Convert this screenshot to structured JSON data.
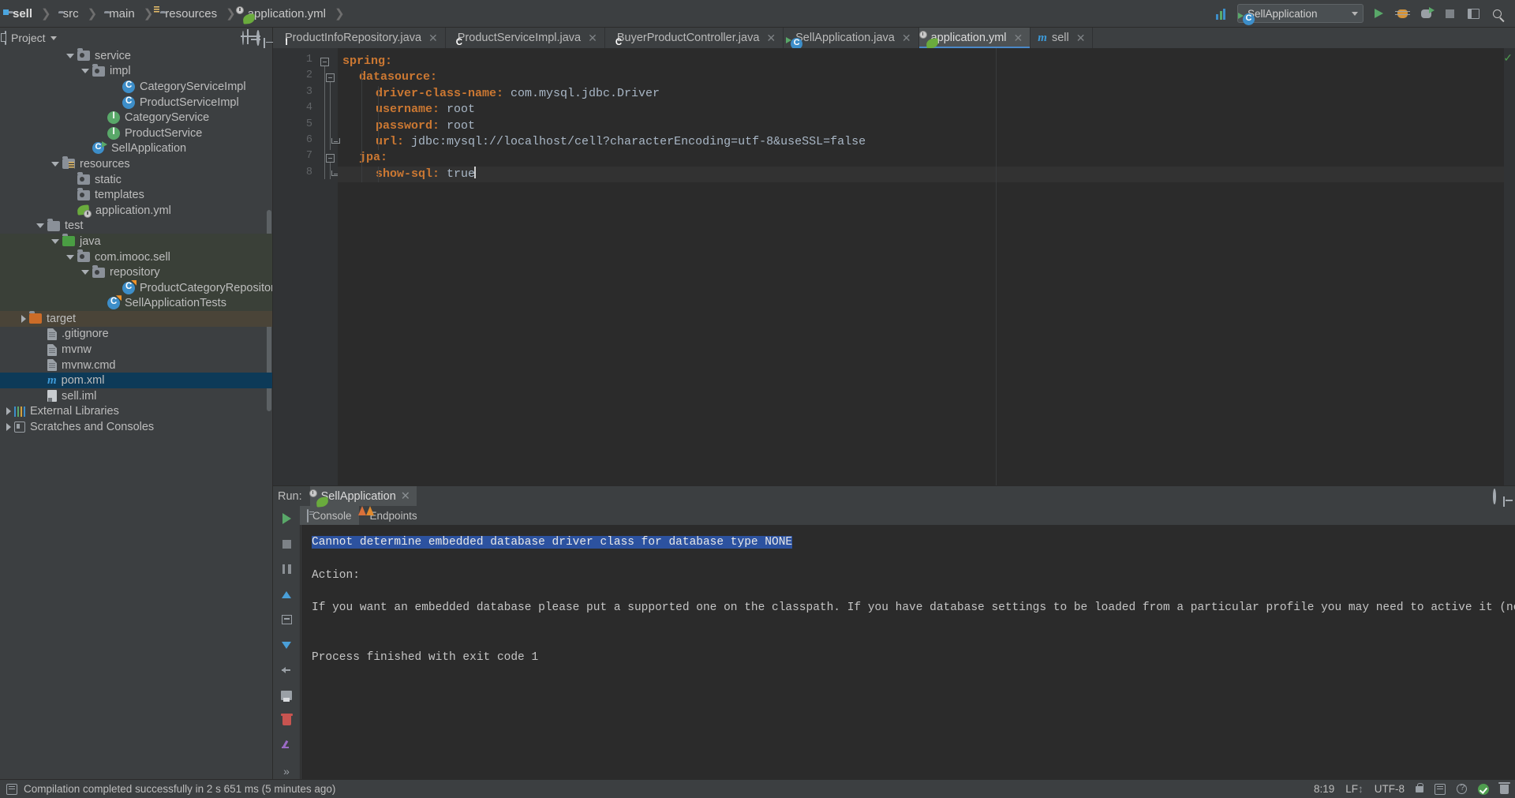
{
  "window": {
    "breadcrumb": [
      {
        "label": "sell",
        "icon": "module-folder-icon"
      },
      {
        "label": "src",
        "icon": "folder-icon"
      },
      {
        "label": "main",
        "icon": "folder-icon"
      },
      {
        "label": "resources",
        "icon": "resources-folder-icon"
      },
      {
        "label": "application.yml",
        "icon": "spring-yml-icon"
      }
    ],
    "run_configuration": "SellApplication",
    "toolbar_icons": [
      "update-icon",
      "run-icon",
      "debug-icon",
      "run-with-coverage-icon",
      "stop-icon",
      "layout-icon",
      "search-icon"
    ]
  },
  "project_pane": {
    "title": "Project",
    "tools": [
      "target-icon",
      "collapse-all-icon",
      "settings-gear-icon",
      "hide-icon"
    ],
    "tree": [
      {
        "label": "service",
        "indent": 4,
        "arrow": "down",
        "icon": "package-folder-icon"
      },
      {
        "label": "impl",
        "indent": 5,
        "arrow": "down",
        "icon": "package-folder-icon"
      },
      {
        "label": "CategoryServiceImpl",
        "indent": 7,
        "arrow": "none",
        "icon": "java-class-icon"
      },
      {
        "label": "ProductServiceImpl",
        "indent": 7,
        "arrow": "none",
        "icon": "java-class-icon"
      },
      {
        "label": "CategoryService",
        "indent": 6,
        "arrow": "none",
        "icon": "java-interface-icon"
      },
      {
        "label": "ProductService",
        "indent": 6,
        "arrow": "none",
        "icon": "java-interface-icon"
      },
      {
        "label": "SellApplication",
        "indent": 5,
        "arrow": "none",
        "icon": "spring-boot-app-icon"
      },
      {
        "label": "resources",
        "indent": 3,
        "arrow": "down",
        "icon": "resources-folder-icon"
      },
      {
        "label": "static",
        "indent": 4,
        "arrow": "none",
        "icon": "package-folder-icon"
      },
      {
        "label": "templates",
        "indent": 4,
        "arrow": "none",
        "icon": "package-folder-icon"
      },
      {
        "label": "application.yml",
        "indent": 4,
        "arrow": "none",
        "icon": "spring-yml-icon"
      },
      {
        "label": "test",
        "indent": 2,
        "arrow": "down",
        "icon": "folder-icon"
      },
      {
        "label": "java",
        "indent": 3,
        "arrow": "down",
        "icon": "green-source-folder-icon",
        "row_style": "test"
      },
      {
        "label": "com.imooc.sell",
        "indent": 4,
        "arrow": "down",
        "icon": "package-folder-icon",
        "row_style": "test"
      },
      {
        "label": "repository",
        "indent": 5,
        "arrow": "down",
        "icon": "package-folder-icon",
        "row_style": "test"
      },
      {
        "label": "ProductCategoryRepositoryTest",
        "indent": 7,
        "arrow": "none",
        "icon": "java-test-class-icon",
        "row_style": "test"
      },
      {
        "label": "SellApplicationTests",
        "indent": 6,
        "arrow": "none",
        "icon": "java-test-class-icon",
        "row_style": "test"
      },
      {
        "label": "target",
        "indent": 1,
        "arrow": "right",
        "icon": "orange-folder-icon",
        "row_style": "target"
      },
      {
        "label": ".gitignore",
        "indent": 2,
        "arrow": "none",
        "icon": "file-icon"
      },
      {
        "label": "mvnw",
        "indent": 2,
        "arrow": "none",
        "icon": "file-icon"
      },
      {
        "label": "mvnw.cmd",
        "indent": 2,
        "arrow": "none",
        "icon": "file-icon"
      },
      {
        "label": "pom.xml",
        "indent": 2,
        "arrow": "none",
        "icon": "maven-icon",
        "row_style": "selected"
      },
      {
        "label": "sell.iml",
        "indent": 2,
        "arrow": "none",
        "icon": "iml-icon"
      },
      {
        "label": "External Libraries",
        "indent": 0,
        "arrow": "right",
        "icon": "libraries-icon"
      },
      {
        "label": "Scratches and Consoles",
        "indent": 0,
        "arrow": "right",
        "icon": "scratches-icon"
      }
    ]
  },
  "editor": {
    "tabs": [
      {
        "label": "ProductInfoRepository.java",
        "icon": "java-interface-icon",
        "active": false,
        "closable": true
      },
      {
        "label": "ProductServiceImpl.java",
        "icon": "java-class-icon",
        "active": false,
        "closable": true
      },
      {
        "label": "BuyerProductController.java",
        "icon": "java-class-icon",
        "active": false,
        "closable": true
      },
      {
        "label": "SellApplication.java",
        "icon": "spring-boot-app-icon",
        "active": false,
        "closable": true
      },
      {
        "label": "application.yml",
        "icon": "spring-yml-icon",
        "active": true,
        "closable": true
      },
      {
        "label": "sell",
        "icon": "maven-icon",
        "active": false,
        "closable": true
      }
    ],
    "lines": [
      {
        "n": "1",
        "indent": 0,
        "key": "spring:",
        "value": "",
        "fold": "start"
      },
      {
        "n": "2",
        "indent": 1,
        "key": "datasource:",
        "value": "",
        "fold": "start"
      },
      {
        "n": "3",
        "indent": 2,
        "key": "driver-class-name:",
        "value": " com.mysql.jdbc.Driver",
        "fold": "none"
      },
      {
        "n": "4",
        "indent": 2,
        "key": "username:",
        "value": " root",
        "fold": "none"
      },
      {
        "n": "5",
        "indent": 2,
        "key": "password:",
        "value": " root",
        "fold": "none"
      },
      {
        "n": "6",
        "indent": 2,
        "key": "url:",
        "value": " jdbc:mysql://localhost/cell?characterEncoding=utf-8&useSSL=false",
        "fold": "end"
      },
      {
        "n": "7",
        "indent": 1,
        "key": "jpa:",
        "value": "",
        "fold": "start"
      },
      {
        "n": "8",
        "indent": 2,
        "key": "show-sql:",
        "value": " true",
        "fold": "end",
        "caret": true
      }
    ],
    "inspection_status": "ok-check-icon"
  },
  "run_panel": {
    "label": "Run:",
    "config_name": "SellApplication",
    "sub_tabs": [
      {
        "label": "Console",
        "icon": "console-icon",
        "active": true
      },
      {
        "label": "Endpoints",
        "icon": "endpoints-icon",
        "active": false
      }
    ],
    "side_icons": [
      "rerun-icon",
      "stop-icon",
      "pause-icon",
      "scroll-up-icon",
      "scroll-down-icon",
      "print-icon",
      "soft-wrap-icon",
      "clear-all-icon",
      "pin-icon",
      "more-icon"
    ],
    "header_icons": [
      "settings-gear-icon",
      "hide-icon"
    ],
    "console_lines": [
      {
        "text": "Cannot determine embedded database driver class for database type NONE",
        "highlighted": true
      },
      {
        "text": "",
        "highlighted": false
      },
      {
        "text": "Action:",
        "highlighted": false
      },
      {
        "text": "",
        "highlighted": false
      },
      {
        "text": "If you want an embedded database please put a supported one on the classpath. If you have database settings to be loaded from a particular profile you may need to active it (no profiles are currently active).",
        "highlighted": false
      },
      {
        "text": "",
        "highlighted": false
      },
      {
        "text": "",
        "highlighted": false
      },
      {
        "text": "Process finished with exit code 1",
        "highlighted": false
      }
    ]
  },
  "status_bar": {
    "message": "Compilation completed successfully in 2 s 651 ms (5 minutes ago)",
    "caret_position": "8:19",
    "line_separator": "LF",
    "encoding": "UTF-8",
    "icons": [
      "lock-icon",
      "event-log-icon",
      "help-icon",
      "inspections-ok-icon",
      "trash-icon"
    ]
  },
  "colors": {
    "accent_blue": "#4a88c7",
    "selection_blue": "#2c52a0",
    "key_orange": "#cc7832",
    "value_gray": "#a9b7c6",
    "panel_bg": "#3c3f41",
    "editor_bg": "#2b2b2b"
  }
}
